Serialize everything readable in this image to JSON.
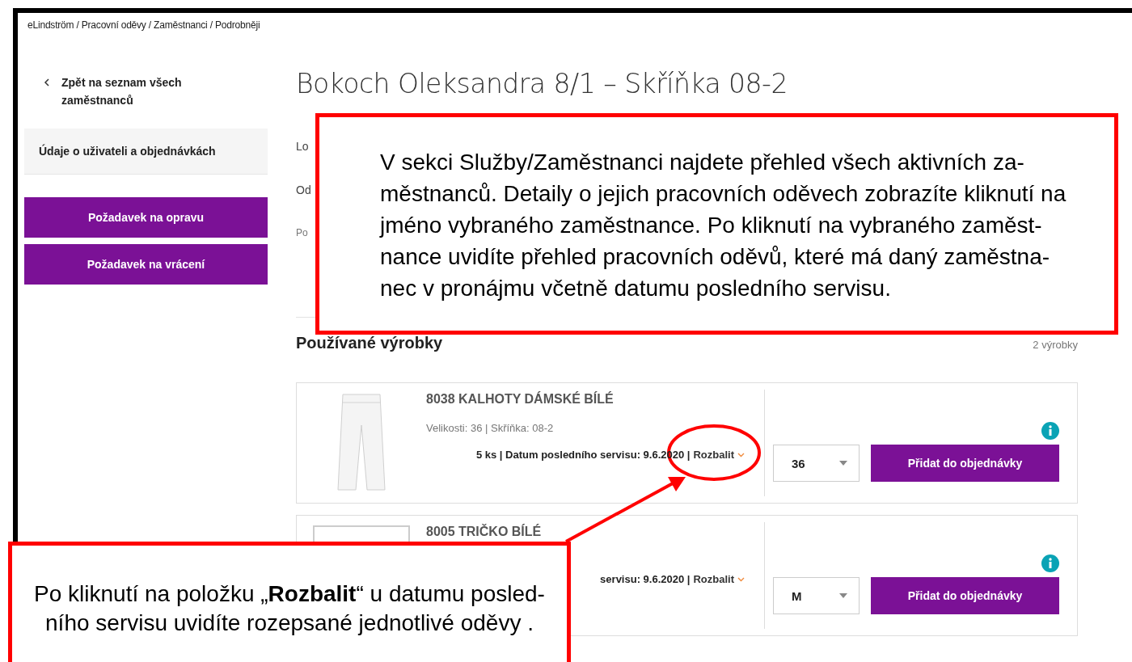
{
  "breadcrumb": "eLindström / Pracovní oděvy / Zaměstnanci / Podrobněji",
  "sidebar": {
    "back_link": "Zpět na seznam všech zaměstnanců",
    "menu_items": [
      {
        "label": "Údaje o uživateli a objednávkách",
        "selected": true
      }
    ],
    "buttons": [
      "Požadavek na opravu",
      "Požadavek na vrácení"
    ]
  },
  "main": {
    "title": "Bokoch Oleksandra 8/1 – Skříňka 08-2",
    "info_fragments": [
      "Lo",
      "Od",
      "Po"
    ],
    "section_title": "Používané výrobky",
    "section_count": "2 výrobky"
  },
  "products": [
    {
      "has_photo": true,
      "name": "8038 KALHOTY DÁMSKÉ BÍLÉ",
      "sizes": "Velikosti: 36 | Skříňka: 08-2",
      "detail": "5 ks | Datum posledního servisu: 9.6.2020 |",
      "expand": "Rozbalit",
      "size": "36",
      "button": "Přidat do objednávky"
    },
    {
      "has_photo": false,
      "name": "8005 TRIČKO BÍLÉ",
      "detail": "servisu: 9.6.2020 |",
      "expand": "Rozbalit",
      "size": "M",
      "button": "Přidat do objednávky"
    }
  ],
  "annotations": {
    "top_note": "V sekci Služby/Zaměstnanci  najdete přehled všech aktivních za-\nměstnanců. Detaily o jejich pracovních oděvech zobrazíte kliknutí na\njméno vybraného zaměstnance. Po kliknutí na vybraného zaměst-\nnance uvidíte přehled pracovních oděvů, které má daný zaměstna-\nnec v pronájmu včetně datumu posledního servisu.",
    "bottom_note": "Po kliknutí na položku „**Rozbalit**“ u datumu posled-\nního servisu uvidíte rozepsané jednotlivé oděvy ."
  }
}
